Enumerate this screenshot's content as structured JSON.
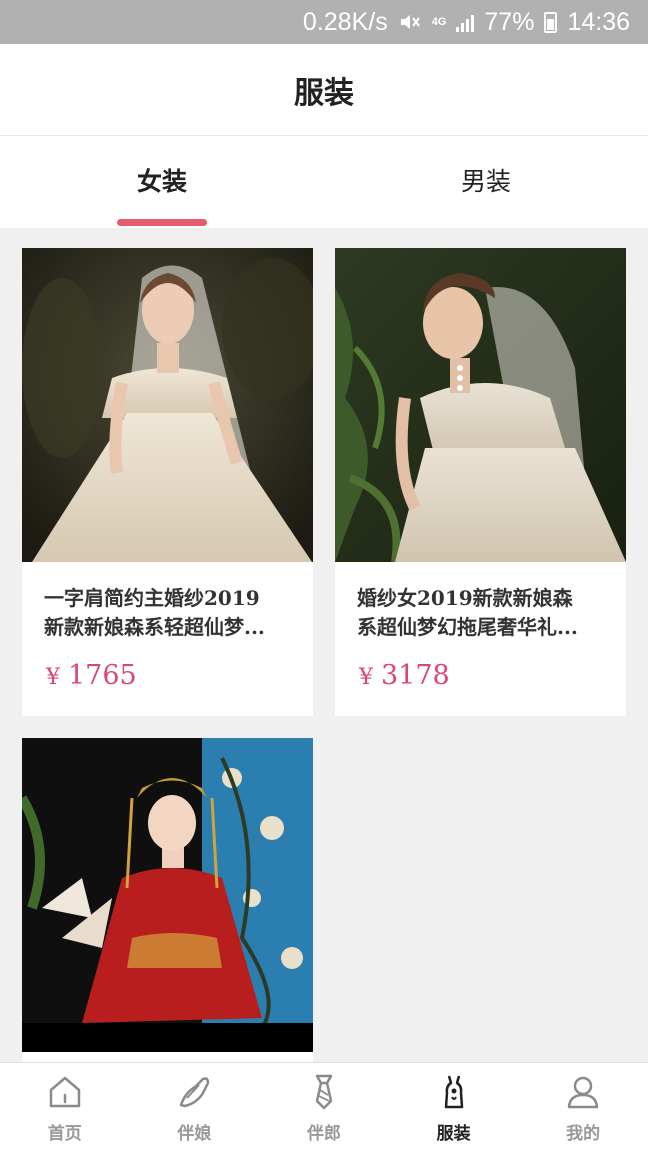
{
  "status_bar": {
    "speed": "0.28K/s",
    "network": "4G",
    "battery": "77%",
    "time": "14:36"
  },
  "header": {
    "title": "服装"
  },
  "tabs": [
    {
      "label": "女装",
      "active": true
    },
    {
      "label": "男装",
      "active": false
    }
  ],
  "products": [
    {
      "title_line1": "一字肩简约主婚纱2019",
      "title_line2": "新款新娘森系轻超仙梦...",
      "currency": "¥",
      "price": "1765"
    },
    {
      "title_line1": "婚纱女2019新款新娘森",
      "title_line2": "系超仙梦幻拖尾奢华礼...",
      "currency": "¥",
      "price": "3178"
    }
  ],
  "bottom_nav": [
    {
      "label": "首页",
      "icon": "home-icon",
      "active": false
    },
    {
      "label": "伴娘",
      "icon": "high-heel-icon",
      "active": false
    },
    {
      "label": "伴郎",
      "icon": "tie-icon",
      "active": false
    },
    {
      "label": "服装",
      "icon": "dress-icon",
      "active": true
    },
    {
      "label": "我的",
      "icon": "user-icon",
      "active": false
    }
  ],
  "colors": {
    "accent": "#e65c6e",
    "price": "#d9467b",
    "status_bar": "#b1b1b1",
    "background": "#f0f0f0"
  }
}
